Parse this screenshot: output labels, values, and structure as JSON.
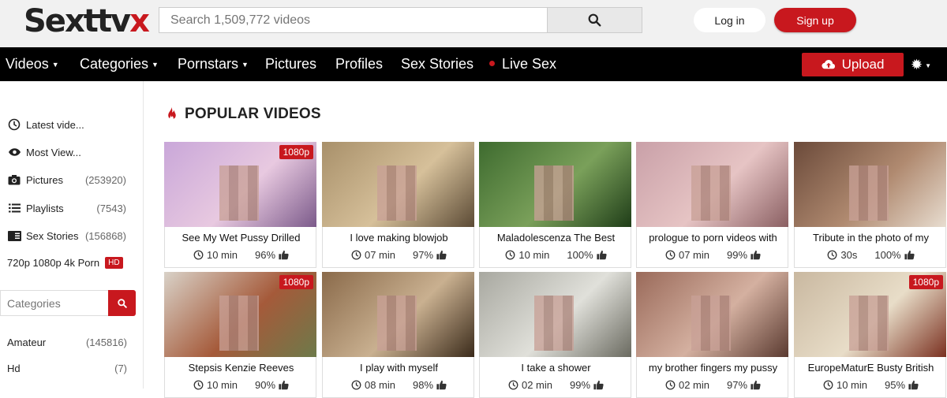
{
  "header": {
    "logo_main": "Sexttv",
    "logo_accent": "x",
    "search_placeholder": "Search 1,509,772 videos",
    "login_label": "Log in",
    "signup_label": "Sign up"
  },
  "nav": {
    "items": [
      {
        "label": "Videos",
        "dropdown": true
      },
      {
        "label": "Categories",
        "dropdown": true
      },
      {
        "label": "Pornstars",
        "dropdown": true
      },
      {
        "label": "Pictures",
        "dropdown": false
      },
      {
        "label": "Profiles",
        "dropdown": false
      },
      {
        "label": "Sex Stories",
        "dropdown": false
      },
      {
        "label": "Live Sex",
        "dropdown": false
      }
    ],
    "upload_label": "Upload"
  },
  "sidebar": {
    "items": [
      {
        "label": "Latest vide...",
        "count": "",
        "icon": "clock-icon"
      },
      {
        "label": "Most View...",
        "count": "",
        "icon": "eye-icon"
      },
      {
        "label": "Pictures",
        "count": "(253920)",
        "icon": "camera-icon"
      },
      {
        "label": "Playlists",
        "count": "(7543)",
        "icon": "list-icon"
      },
      {
        "label": "Sex Stories",
        "count": "(156868)",
        "icon": "book-icon"
      }
    ],
    "hd_label": "720p 1080p 4k Porn",
    "hd_badge": "HD",
    "categories_placeholder": "Categories",
    "categories": [
      {
        "label": "Amateur",
        "count": "(145816)"
      },
      {
        "label": "Hd",
        "count": "(7)"
      }
    ]
  },
  "main": {
    "section_title": "POPULAR VIDEOS",
    "videos": [
      {
        "title": "See My Wet Pussy Drilled",
        "duration": "10 min",
        "rating": "96%",
        "badge": "1080p"
      },
      {
        "title": "I love making blowjob",
        "duration": "07 min",
        "rating": "97%",
        "badge": ""
      },
      {
        "title": "Maladolescenza The Best",
        "duration": "10 min",
        "rating": "100%",
        "badge": ""
      },
      {
        "title": "prologue to porn videos with",
        "duration": "07 min",
        "rating": "99%",
        "badge": ""
      },
      {
        "title": "Tribute in the photo of my",
        "duration": "30s",
        "rating": "100%",
        "badge": ""
      },
      {
        "title": "Stepsis Kenzie Reeves",
        "duration": "10 min",
        "rating": "90%",
        "badge": "1080p"
      },
      {
        "title": "I play with myself",
        "duration": "08 min",
        "rating": "98%",
        "badge": ""
      },
      {
        "title": "I take a shower",
        "duration": "02 min",
        "rating": "99%",
        "badge": ""
      },
      {
        "title": "my brother fingers my pussy",
        "duration": "02 min",
        "rating": "97%",
        "badge": ""
      },
      {
        "title": "EuropeMaturE Busty British",
        "duration": "10 min",
        "rating": "95%",
        "badge": "1080p"
      }
    ]
  },
  "colors": {
    "accent": "#c8181e",
    "nav_bg": "#000000",
    "header_bg": "#f1f1f1"
  }
}
